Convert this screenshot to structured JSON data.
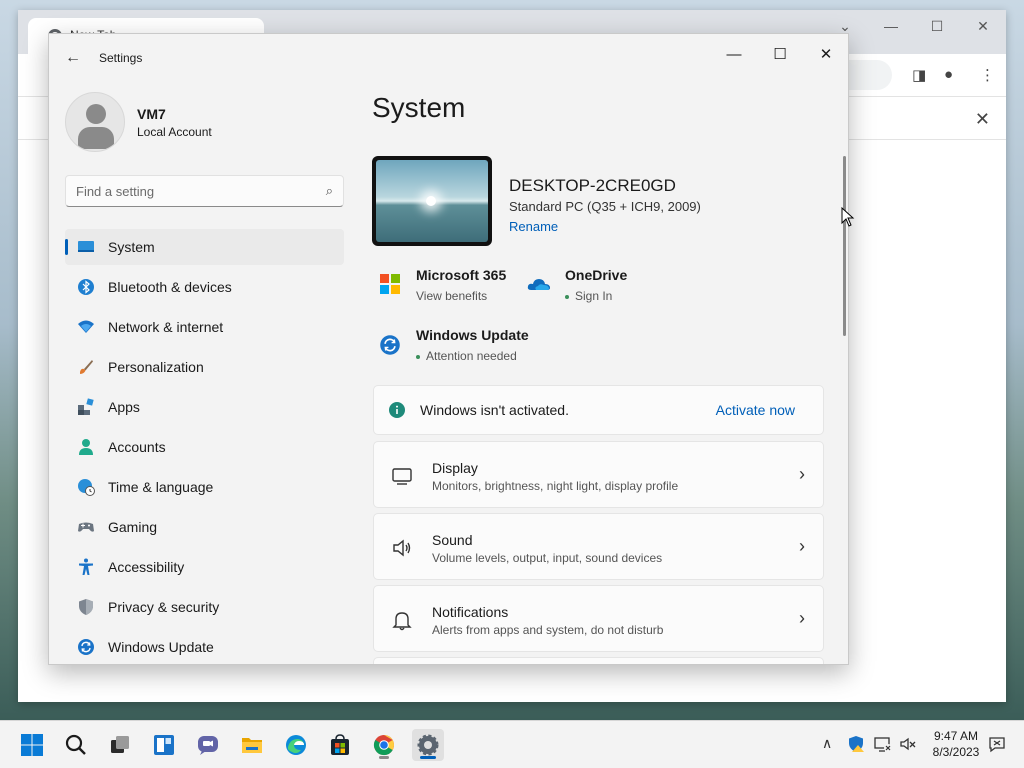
{
  "settings": {
    "window_title": "Settings",
    "user": {
      "name": "VM7",
      "account_type": "Local Account"
    },
    "search": {
      "placeholder": "Find a setting"
    },
    "nav": [
      {
        "label": "System",
        "icon": "monitor-icon",
        "active": true
      },
      {
        "label": "Bluetooth & devices",
        "icon": "bluetooth-icon"
      },
      {
        "label": "Network & internet",
        "icon": "wifi-icon"
      },
      {
        "label": "Personalization",
        "icon": "brush-icon"
      },
      {
        "label": "Apps",
        "icon": "apps-icon"
      },
      {
        "label": "Accounts",
        "icon": "person-icon"
      },
      {
        "label": "Time & language",
        "icon": "globe-clock-icon"
      },
      {
        "label": "Gaming",
        "icon": "gamepad-icon"
      },
      {
        "label": "Accessibility",
        "icon": "accessibility-icon"
      },
      {
        "label": "Privacy & security",
        "icon": "shield-icon"
      },
      {
        "label": "Windows Update",
        "icon": "update-icon"
      }
    ],
    "page_title": "System",
    "device": {
      "name": "DESKTOP-2CRE0GD",
      "spec": "Standard PC (Q35 + ICH9, 2009)",
      "rename_link": "Rename"
    },
    "tiles": {
      "microsoft365": {
        "title": "Microsoft 365",
        "sub": "View benefits"
      },
      "onedrive": {
        "title": "OneDrive",
        "sub": "Sign In"
      },
      "windows_update": {
        "title": "Windows Update",
        "sub": "Attention needed"
      }
    },
    "activation": {
      "message": "Windows isn't activated.",
      "action": "Activate now"
    },
    "cards": [
      {
        "title": "Display",
        "sub": "Monitors, brightness, night light, display profile",
        "icon": "display-icon"
      },
      {
        "title": "Sound",
        "sub": "Volume levels, output, input, sound devices",
        "icon": "speaker-icon"
      },
      {
        "title": "Notifications",
        "sub": "Alerts from apps and system, do not disturb",
        "icon": "bell-icon"
      }
    ]
  },
  "browser": {
    "tab_title": "New Tab"
  },
  "taskbar": {
    "time": "9:47 AM",
    "date": "8/3/2023"
  },
  "colors": {
    "accent": "#005fb8",
    "window_bg": "#f3f3f3",
    "card_bg": "#fbfbfb"
  }
}
